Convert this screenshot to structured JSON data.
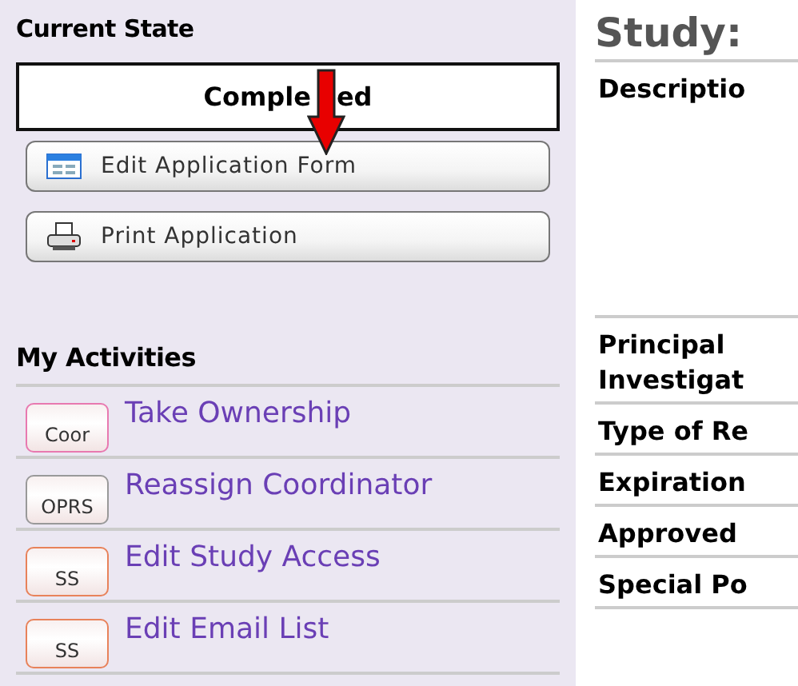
{
  "sidebar": {
    "current_state": {
      "heading": "Current State",
      "value_parts": [
        "Comple",
        "ed"
      ]
    },
    "actions": [
      {
        "kind": "form",
        "label": "Edit Application Form"
      },
      {
        "kind": "print",
        "label": "Print Application"
      }
    ],
    "activities_heading": "My Activities",
    "activities": [
      {
        "badge": "Coor",
        "color": "#e879b0",
        "label": "Take Ownership"
      },
      {
        "badge": "OPRS",
        "color": "#999999",
        "label": "Reassign Coordinator"
      },
      {
        "badge": "SS",
        "color": "#e8825a",
        "label": "Edit Study Access"
      },
      {
        "badge": "SS",
        "color": "#e8825a",
        "label": "Edit Email List"
      }
    ]
  },
  "main": {
    "title": "Study:",
    "fields": [
      {
        "label": "Descriptio",
        "tall": true
      },
      {
        "label": "Principal\nInvestigat",
        "tall": false
      },
      {
        "label": "Type of Re",
        "tall": false
      },
      {
        "label": "Expiration",
        "tall": false
      },
      {
        "label": "Approved",
        "tall": false
      },
      {
        "label": "Special Po",
        "tall": false
      }
    ]
  }
}
